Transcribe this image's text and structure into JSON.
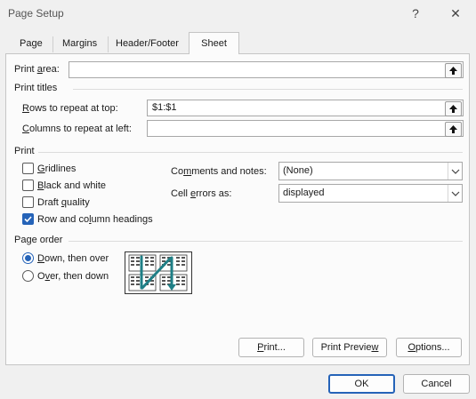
{
  "dialog": {
    "title": "Page Setup",
    "help": "?",
    "close": "✕"
  },
  "tabs": [
    {
      "label": "Page",
      "active": false
    },
    {
      "label": "Margins",
      "active": false
    },
    {
      "label": "Header/Footer",
      "active": false
    },
    {
      "label": "Sheet",
      "active": true
    }
  ],
  "print_area": {
    "label_pre": "Print ",
    "label_u": "a",
    "label_post": "rea:",
    "value": ""
  },
  "print_titles": {
    "heading": "Print titles",
    "rows": {
      "label_u": "R",
      "label_post": "ows to repeat at top:",
      "value": "$1:$1"
    },
    "cols": {
      "label_u": "C",
      "label_post": "olumns to repeat at left:",
      "value": ""
    }
  },
  "print": {
    "heading": "Print",
    "gridlines": {
      "label_u": "G",
      "label_post": "ridlines",
      "checked": false
    },
    "black_white": {
      "label_u": "B",
      "label_post": "lack and white",
      "checked": false
    },
    "draft": {
      "label_pre": "Draft ",
      "label_u": "q",
      "label_post": "uality",
      "checked": false
    },
    "headings": {
      "label_pre": "Row and co",
      "label_u": "l",
      "label_post": "umn headings",
      "checked": true
    },
    "comments": {
      "label_pre": "Co",
      "label_u": "m",
      "label_post": "ments and notes:",
      "value": "(None)"
    },
    "errors": {
      "label_pre": "Cell ",
      "label_u": "e",
      "label_post": "rrors as:",
      "value": "displayed"
    }
  },
  "page_order": {
    "heading": "Page order",
    "down": {
      "label_u": "D",
      "label_post": "own, then over",
      "selected": true
    },
    "over": {
      "label_pre": "O",
      "label_u": "v",
      "label_post": "er, then down",
      "selected": false
    }
  },
  "buttons": {
    "print": {
      "label_u": "P",
      "label_post": "rint..."
    },
    "preview": {
      "label_pre": "Print Previe",
      "label_u": "w",
      "label_post": ""
    },
    "options": {
      "label_u": "O",
      "label_post": "ptions..."
    },
    "ok": "OK",
    "cancel": "Cancel"
  },
  "colors": {
    "accent": "#2563b8",
    "panel": "#fbfbfb",
    "window": "#f0f0f0"
  }
}
